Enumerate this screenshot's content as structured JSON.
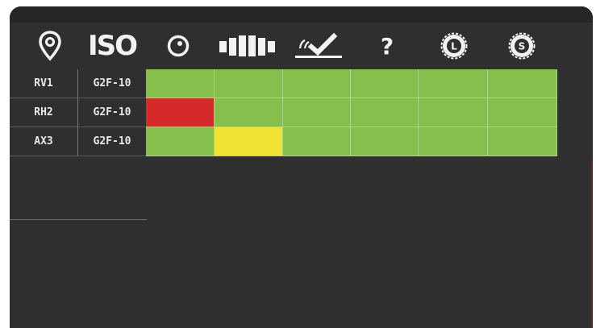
{
  "toolbar": {
    "tools": [
      {
        "icon": "location-pin-icon"
      },
      {
        "icon": "iso-icon",
        "label": "ISO"
      },
      {
        "icon": "gauge-icon"
      },
      {
        "icon": "tread-blocks-icon"
      },
      {
        "icon": "inspection-check-icon"
      },
      {
        "icon": "help-icon",
        "label": "?"
      },
      {
        "icon": "tire-l-icon",
        "label": "L"
      },
      {
        "icon": "tire-s-icon",
        "label": "S"
      }
    ]
  },
  "table": {
    "rows": [
      {
        "id": "RV1",
        "model": "G2F-10",
        "status": [
          "green",
          "green",
          "green",
          "green",
          "green",
          "green"
        ]
      },
      {
        "id": "RH2",
        "model": "G2F-10",
        "status": [
          "red",
          "green",
          "green",
          "green",
          "green",
          "green"
        ]
      },
      {
        "id": "AX3",
        "model": "G2F-10",
        "status": [
          "green",
          "yellow",
          "green",
          "green",
          "green",
          "green"
        ]
      }
    ]
  },
  "colors": {
    "panel": "#2f2f2f",
    "green": "#86c04c",
    "red": "#d42a2a",
    "yellow": "#f2e233"
  }
}
